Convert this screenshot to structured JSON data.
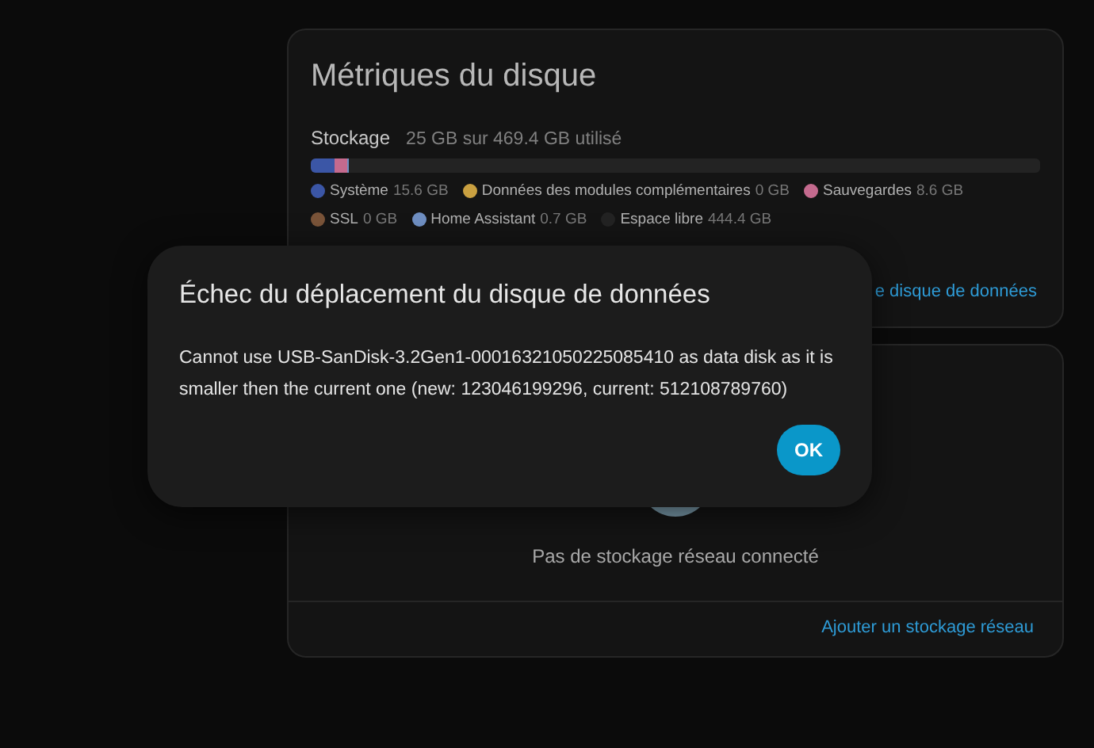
{
  "disk_metrics": {
    "title": "Métriques du disque",
    "storage_label": "Stockage",
    "storage_usage": "25 GB sur 469.4 GB utilisé",
    "segments": [
      {
        "name": "Système",
        "value": "15.6 GB",
        "color": "#3b56a6",
        "level": 0.033
      },
      {
        "name": "Données des modules complémentaires",
        "value": "0 GB",
        "color": "#c9a040"
      },
      {
        "name": "Sauvegardes",
        "value": "8.6 GB",
        "color": "#c46a8e",
        "level": 0.018
      },
      {
        "name": "SSL",
        "value": "0 GB",
        "color": "#7a5439"
      },
      {
        "name": "Home Assistant",
        "value": "0.7 GB",
        "color": "#6f8fc2",
        "level": 0.0015
      },
      {
        "name": "Espace libre",
        "value": "444.4 GB",
        "color": "#232323",
        "level": 0.9475
      }
    ],
    "action": "e disque de données"
  },
  "network_storage": {
    "empty_text": "Pas de stockage réseau connecté",
    "action": "Ajouter un stockage réseau"
  },
  "dialog": {
    "title": "Échec du déplacement du disque de données",
    "message": "Cannot use USB-SanDisk-3.2Gen1-00016321050225085410 as data disk as it is smaller then the current one (new: 123046199296, current: 512108789760)",
    "button": "OK"
  }
}
